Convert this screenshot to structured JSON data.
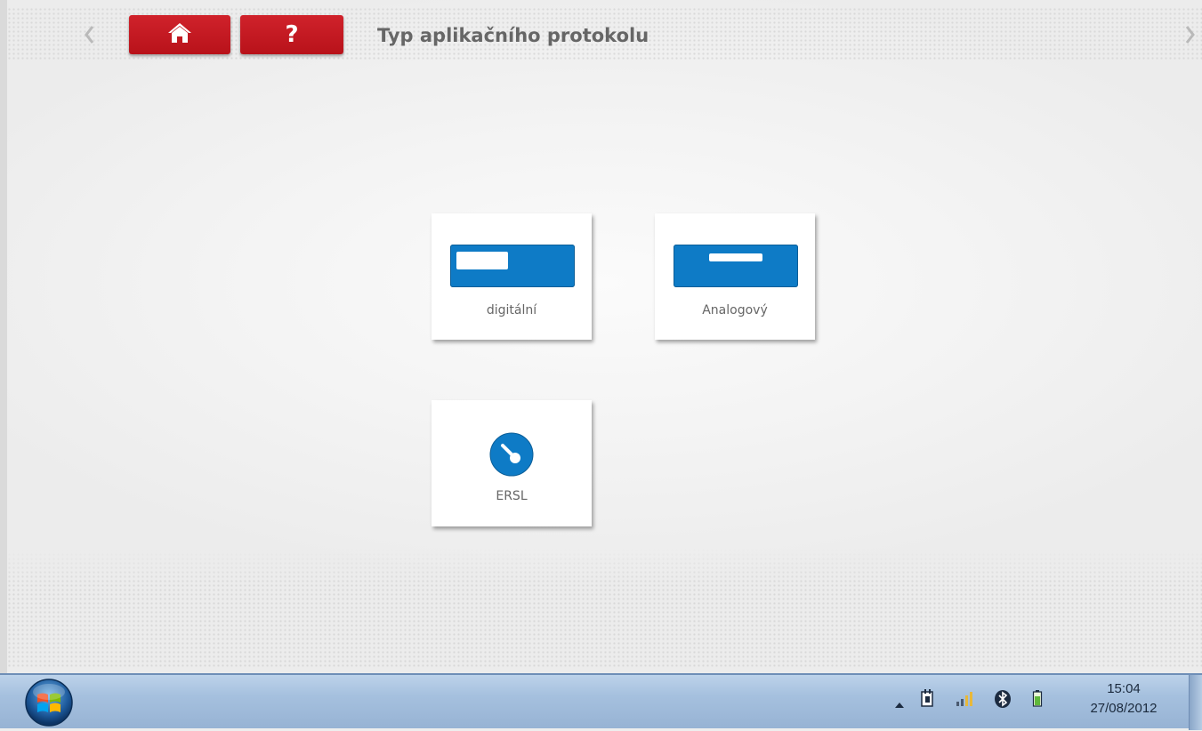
{
  "header": {
    "title": "Typ aplikačního protokolu",
    "back_icon": "chevron-left-icon",
    "forward_icon": "chevron-right-icon",
    "home_icon": "home-icon",
    "help_label": "?"
  },
  "options": [
    {
      "label": "digitální",
      "icon": "digital-card-icon"
    },
    {
      "label": "Analogový",
      "icon": "analog-card-icon"
    },
    {
      "label": "ERSL",
      "icon": "ersl-gauge-icon"
    }
  ],
  "taskbar": {
    "time": "15:04",
    "date": "27/08/2012"
  },
  "colors": {
    "accent_red": "#c21a22",
    "icon_blue": "#0e7bc6",
    "text_gray": "#666666"
  }
}
